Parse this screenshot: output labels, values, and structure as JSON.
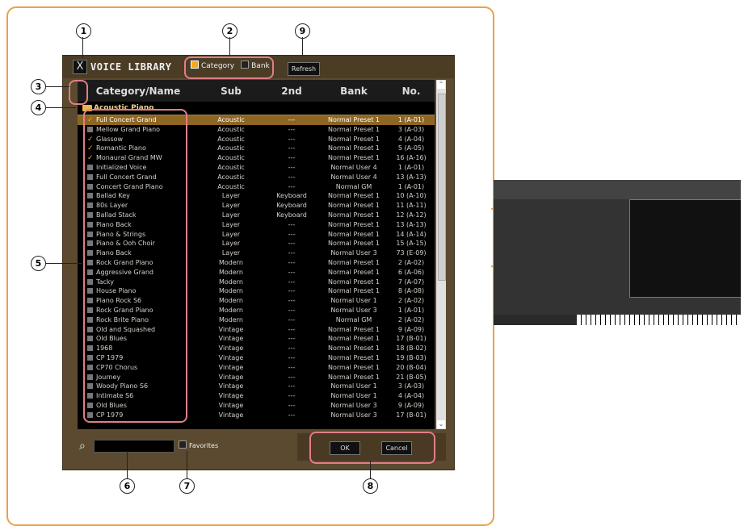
{
  "callouts": [
    "1",
    "2",
    "3",
    "4",
    "5",
    "6",
    "7",
    "8",
    "9"
  ],
  "window": {
    "title": "VOICE LIBRARY",
    "close": "X"
  },
  "filters": [
    {
      "label": "Category"
    },
    {
      "label": "Bank"
    }
  ],
  "refresh": "Refresh",
  "expand_icons": [
    "⊞",
    "⊟"
  ],
  "columns": [
    "Category/Name",
    "Sub",
    "2nd",
    "Bank",
    "No."
  ],
  "group": "Acoustic Piano",
  "rows": [
    [
      "Full Concert Grand",
      "Acoustic",
      "---",
      "Normal Preset 1",
      "1 (A-01)",
      "check",
      true
    ],
    [
      "Mellow Grand Piano",
      "Acoustic",
      "---",
      "Normal Preset 1",
      "3 (A-03)",
      "box",
      false
    ],
    [
      "Glassow",
      "Acoustic",
      "---",
      "Normal Preset 1",
      "4 (A-04)",
      "check",
      false
    ],
    [
      "Romantic Piano",
      "Acoustic",
      "---",
      "Normal Preset 1",
      "5 (A-05)",
      "check",
      false
    ],
    [
      "Monaural Grand MW",
      "Acoustic",
      "---",
      "Normal Preset 1",
      "16 (A-16)",
      "check",
      false
    ],
    [
      "Initialized Voice",
      "Acoustic",
      "---",
      "Normal User 4",
      "1 (A-01)",
      "box",
      false
    ],
    [
      "Full Concert Grand",
      "Acoustic",
      "---",
      "Normal User 4",
      "13 (A-13)",
      "box",
      false
    ],
    [
      "Concert Grand Piano",
      "Acoustic",
      "---",
      "Normal GM",
      "1 (A-01)",
      "box",
      false
    ],
    [
      "Ballad Key",
      "Layer",
      "Keyboard",
      "Normal Preset 1",
      "10 (A-10)",
      "box",
      false
    ],
    [
      "80s Layer",
      "Layer",
      "Keyboard",
      "Normal Preset 1",
      "11 (A-11)",
      "box",
      false
    ],
    [
      "Ballad Stack",
      "Layer",
      "Keyboard",
      "Normal Preset 1",
      "12 (A-12)",
      "box",
      false
    ],
    [
      "Piano Back",
      "Layer",
      "---",
      "Normal Preset 1",
      "13 (A-13)",
      "box",
      false
    ],
    [
      "Piano & Strings",
      "Layer",
      "---",
      "Normal Preset 1",
      "14 (A-14)",
      "box",
      false
    ],
    [
      "Piano & Ooh Choir",
      "Layer",
      "---",
      "Normal Preset 1",
      "15 (A-15)",
      "box",
      false
    ],
    [
      "Piano Back",
      "Layer",
      "---",
      "Normal User 3",
      "73 (E-09)",
      "box",
      false
    ],
    [
      "Rock Grand Piano",
      "Modern",
      "---",
      "Normal Preset 1",
      "2 (A-02)",
      "box",
      false
    ],
    [
      "Aggressive Grand",
      "Modern",
      "---",
      "Normal Preset 1",
      "6 (A-06)",
      "box",
      false
    ],
    [
      "Tacky",
      "Modern",
      "---",
      "Normal Preset 1",
      "7 (A-07)",
      "box",
      false
    ],
    [
      "House Piano",
      "Modern",
      "---",
      "Normal Preset 1",
      "8 (A-08)",
      "box",
      false
    ],
    [
      "Piano Rock S6",
      "Modern",
      "---",
      "Normal User 1",
      "2 (A-02)",
      "box",
      false
    ],
    [
      "Rock Grand Piano",
      "Modern",
      "---",
      "Normal User 3",
      "1 (A-01)",
      "box",
      false
    ],
    [
      "Rock Brite Piano",
      "Modern",
      "---",
      "Normal GM",
      "2 (A-02)",
      "box",
      false
    ],
    [
      "Old and Squashed",
      "Vintage",
      "---",
      "Normal Preset 1",
      "9 (A-09)",
      "box",
      false
    ],
    [
      "Old Blues",
      "Vintage",
      "---",
      "Normal Preset 1",
      "17 (B-01)",
      "box",
      false
    ],
    [
      "1968",
      "Vintage",
      "---",
      "Normal Preset 1",
      "18 (B-02)",
      "box",
      false
    ],
    [
      "CP 1979",
      "Vintage",
      "---",
      "Normal Preset 1",
      "19 (B-03)",
      "box",
      false
    ],
    [
      "CP70 Chorus",
      "Vintage",
      "---",
      "Normal Preset 1",
      "20 (B-04)",
      "box",
      false
    ],
    [
      "Journey",
      "Vintage",
      "---",
      "Normal Preset 1",
      "21 (B-05)",
      "box",
      false
    ],
    [
      "Woody Piano S6",
      "Vintage",
      "---",
      "Normal User 1",
      "3 (A-03)",
      "box",
      false
    ],
    [
      "Intimate S6",
      "Vintage",
      "---",
      "Normal User 1",
      "4 (A-04)",
      "box",
      false
    ],
    [
      "Old Blues",
      "Vintage",
      "---",
      "Normal User 3",
      "9 (A-09)",
      "box",
      false
    ],
    [
      "CP 1979",
      "Vintage",
      "---",
      "Normal User 3",
      "17 (B-01)",
      "box",
      false
    ]
  ],
  "search": {
    "icon": "⌕"
  },
  "favorites": "Favorites",
  "buttons": {
    "ok": "OK",
    "cancel": "Cancel"
  },
  "colors": {
    "accent": "#f3a91a",
    "callout": "#e27d88",
    "frame": "#e8a24a"
  }
}
